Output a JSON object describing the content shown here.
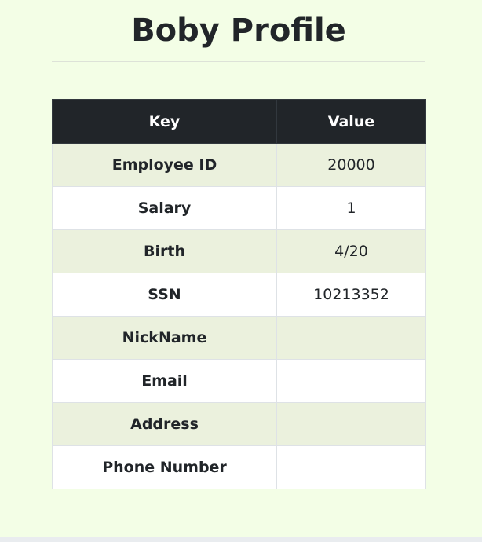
{
  "page": {
    "title": "Boby Profile"
  },
  "table": {
    "headers": {
      "key": "Key",
      "value": "Value"
    },
    "rows": [
      {
        "key": "Employee ID",
        "value": "20000"
      },
      {
        "key": "Salary",
        "value": "1"
      },
      {
        "key": "Birth",
        "value": "4/20"
      },
      {
        "key": "SSN",
        "value": "10213352"
      },
      {
        "key": "NickName",
        "value": ""
      },
      {
        "key": "Email",
        "value": ""
      },
      {
        "key": "Address",
        "value": ""
      },
      {
        "key": "Phone Number",
        "value": ""
      }
    ]
  },
  "colors": {
    "page_background": "#f3fee6",
    "header_background": "#212529",
    "striped_row": "#ebf1dd"
  }
}
